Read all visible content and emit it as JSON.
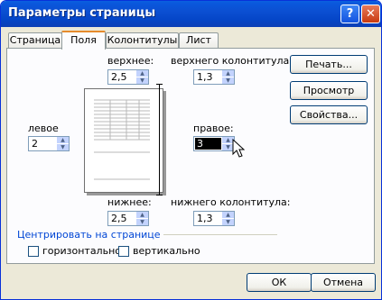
{
  "dialog": {
    "title": "Параметры страницы"
  },
  "titlebar": {
    "help_glyph": "?",
    "close_glyph": "✕"
  },
  "tabs": [
    {
      "label": "Страница",
      "active": false
    },
    {
      "label": "Поля",
      "active": true
    },
    {
      "label": "Колонтитулы",
      "active": false
    },
    {
      "label": "Лист",
      "active": false
    }
  ],
  "margins": {
    "top": {
      "label": "верхнее:",
      "value": "2,5"
    },
    "header": {
      "label": "верхнего колонтитула:",
      "value": "1,3"
    },
    "left": {
      "label": "левое",
      "value": "2"
    },
    "right": {
      "label": "правое:",
      "value": "3"
    },
    "bottom": {
      "label": "нижнее:",
      "value": "2,5"
    },
    "footer": {
      "label": "нижнего колонтитула:",
      "value": "1,3"
    }
  },
  "side_buttons": {
    "print": "Печать...",
    "preview": "Просмотр",
    "properties": "Свойства..."
  },
  "centering": {
    "group_label": "Центрировать на странице",
    "horizontal": {
      "label": "горизонтально",
      "checked": false
    },
    "vertical": {
      "label": "вертикально",
      "checked": false
    }
  },
  "footer_buttons": {
    "ok": "ОК",
    "cancel": "Отмена"
  },
  "colors": {
    "title_bar": "#0a58dc",
    "dialog_bg": "#ece9d8",
    "tab_accent": "#e68b2c"
  }
}
